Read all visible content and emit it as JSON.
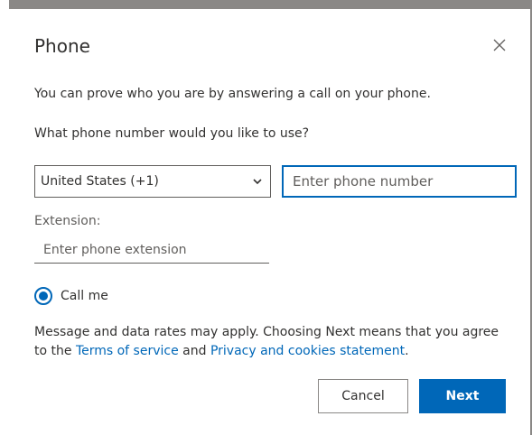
{
  "dialog": {
    "title": "Phone",
    "close_icon": "close-icon",
    "intro_text": "You can prove who you are by answering a call on your phone.",
    "question_text": "What phone number would you like to use?",
    "country_select": {
      "selected": "United States (+1)",
      "icon": "chevron-down-icon"
    },
    "phone_input": {
      "placeholder": "Enter phone number",
      "value": ""
    },
    "extension": {
      "label": "Extension:",
      "placeholder": "Enter phone extension",
      "value": ""
    },
    "method_option": {
      "label": "Call me",
      "selected": true
    },
    "disclaimer": {
      "text_before": "Message and data rates may apply. Choosing Next means that you agree to the ",
      "terms_link": "Terms of service",
      "and": " and ",
      "privacy_link": "Privacy and cookies statement",
      "end": "."
    },
    "buttons": {
      "cancel_label": "Cancel",
      "next_label": "Next"
    }
  },
  "colors": {
    "accent": "#0067b8",
    "text": "#323130",
    "secondary_text": "#605e5c",
    "frame": "#8a8886"
  }
}
